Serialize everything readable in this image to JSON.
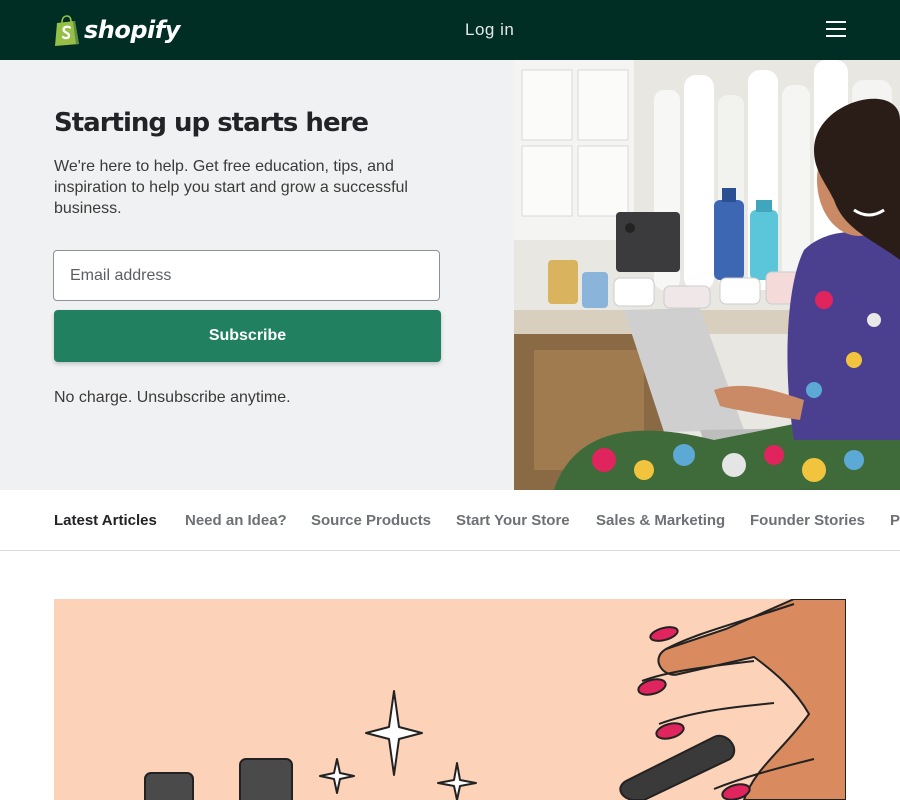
{
  "header": {
    "logo_text": "shopify",
    "login_label": "Log in",
    "menu_icon": "hamburger-icon",
    "colors": {
      "background": "#002e25",
      "logo_bag": "#95bf47"
    }
  },
  "hero": {
    "title": "Starting up starts here",
    "description": "We're here to help. Get free education, tips, and inspiration to help you start and grow a successful business.",
    "email_placeholder": "Email address",
    "email_value": "",
    "subscribe_label": "Subscribe",
    "note": "No charge. Unsubscribe anytime.",
    "colors": {
      "panel": "#f0f1f2",
      "button": "#208060"
    }
  },
  "nav": {
    "items": [
      {
        "label": "Latest Articles",
        "active": true
      },
      {
        "label": "Need an Idea?",
        "active": false
      },
      {
        "label": "Source Products",
        "active": false
      },
      {
        "label": "Start Your Store",
        "active": false
      },
      {
        "label": "Sales & Marketing",
        "active": false
      },
      {
        "label": "Founder Stories",
        "active": false
      },
      {
        "label": "Podcasts",
        "active": false
      }
    ]
  },
  "feature": {
    "colors": {
      "background": "#fcd2b8",
      "nail_polish": "#e0245e",
      "skin": "#d98a5e"
    }
  }
}
